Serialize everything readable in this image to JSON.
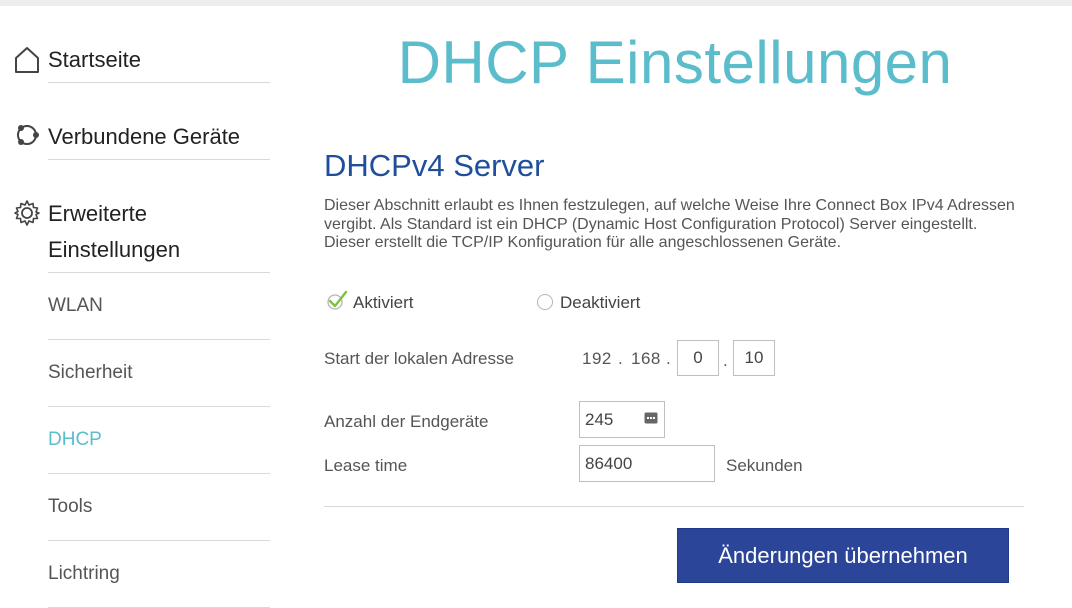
{
  "sidebar": {
    "main_items": [
      {
        "label": "Startseite",
        "icon": "home-icon"
      },
      {
        "label": "Verbundene Geräte",
        "icon": "connected-devices-icon"
      },
      {
        "label_line1": "Erweiterte",
        "label_line2": "Einstellungen",
        "icon": "gear-icon"
      }
    ],
    "sub_items": [
      {
        "label": "WLAN",
        "active": false
      },
      {
        "label": "Sicherheit",
        "active": false
      },
      {
        "label": "DHCP",
        "active": true
      },
      {
        "label": "Tools",
        "active": false
      },
      {
        "label": "Lichtring",
        "active": false
      }
    ]
  },
  "main": {
    "page_title": "DHCP Einstellungen",
    "section_title": "DHCPv4 Server",
    "description": "Dieser Abschnitt erlaubt es Ihnen festzulegen, auf welche Weise Ihre Connect Box IPv4 Adressen vergibt. Als Standard ist ein DHCP (Dynamic Host Configuration Protocol) Server eingestellt. Dieser erstellt die TCP/IP Konfiguration für alle angeschlossenen Geräte.",
    "radio_enabled_label": "Aktiviert",
    "radio_disabled_label": "Deaktiviert",
    "selected_option": "Aktiviert",
    "start_address": {
      "label": "Start der lokalen Adresse",
      "octet1": "192",
      "octet2": "168",
      "octet3": "0",
      "octet4": "10",
      "separator": "."
    },
    "device_count": {
      "label": "Anzahl der Endgeräte",
      "value": "245"
    },
    "lease_time": {
      "label": "Lease time",
      "value": "86400",
      "unit": "Sekunden"
    },
    "apply_button_label": "Änderungen übernehmen"
  },
  "colors": {
    "accent": "#5bbccc",
    "section_title": "#1f4f9c",
    "button": "#2b4699",
    "check": "#7cc242"
  }
}
